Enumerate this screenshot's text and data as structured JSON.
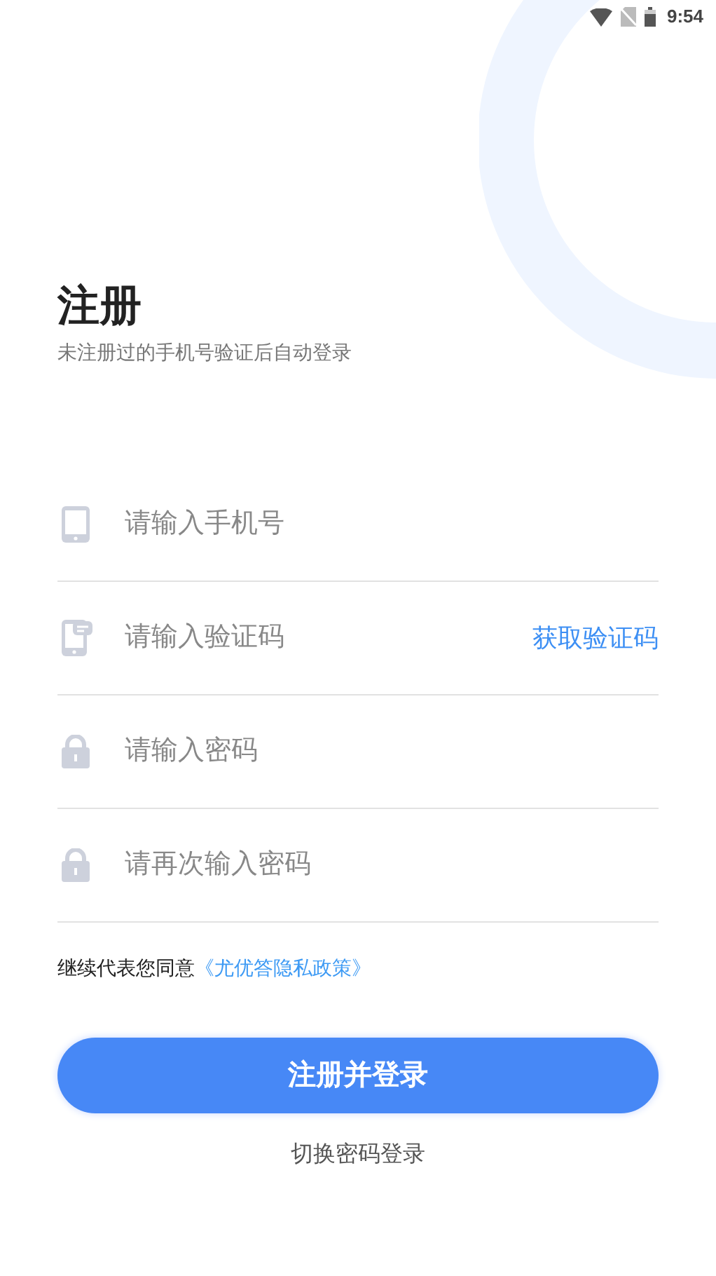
{
  "status_bar": {
    "time": "9:54"
  },
  "header": {
    "title": "注册",
    "subtitle": "未注册过的手机号验证后自动登录"
  },
  "fields": [
    {
      "kind": "phone",
      "placeholder": "请输入手机号"
    },
    {
      "kind": "sms",
      "placeholder": "请输入验证码",
      "action": "获取验证码"
    },
    {
      "kind": "lock",
      "placeholder": "请输入密码"
    },
    {
      "kind": "lock",
      "placeholder": "请再次输入密码"
    }
  ],
  "agreement": {
    "text": "继续代表您同意",
    "link": "《尤优答隐私政策》"
  },
  "submit_button": "注册并登录",
  "switch_link": "切换密码登录"
}
